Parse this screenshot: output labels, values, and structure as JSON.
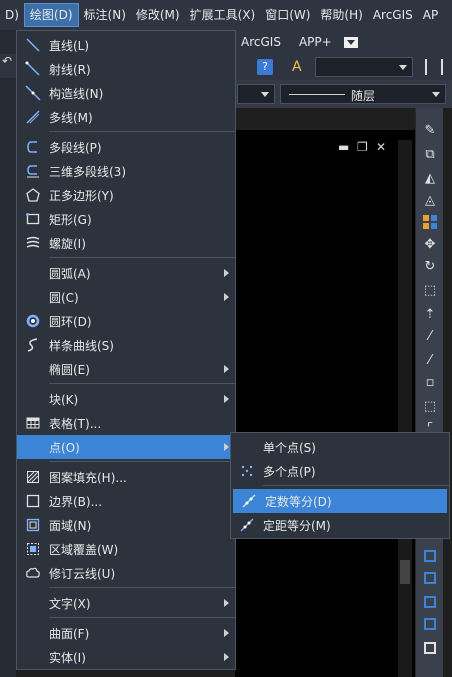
{
  "menubar": {
    "items": [
      "D)",
      "绘图(D)",
      "标注(N)",
      "修改(M)",
      "扩展工具(X)",
      "窗口(W)",
      "帮助(H)",
      "ArcGIS",
      "AP"
    ]
  },
  "toolbar": {
    "arcgis": "ArcGIS",
    "app_plus": "APP+",
    "layer_combo": "随层"
  },
  "draw_menu": {
    "items": [
      {
        "label": "直线(L)",
        "icon": "line-icon"
      },
      {
        "label": "射线(R)",
        "icon": "ray-icon"
      },
      {
        "label": "构造线(N)",
        "icon": "construction-line-icon"
      },
      {
        "label": "多线(M)",
        "icon": "multiline-icon"
      },
      {
        "label": "多段线(P)",
        "icon": "polyline-icon"
      },
      {
        "label": "三维多段线(3)",
        "icon": "3d-polyline-icon"
      },
      {
        "label": "正多边形(Y)",
        "icon": "polygon-icon"
      },
      {
        "label": "矩形(G)",
        "icon": "rectangle-icon"
      },
      {
        "label": "螺旋(I)",
        "icon": "helix-icon"
      },
      {
        "label": "圆弧(A)",
        "icon": "",
        "submenu": true
      },
      {
        "label": "圆(C)",
        "icon": "",
        "submenu": true
      },
      {
        "label": "圆环(D)",
        "icon": "donut-icon"
      },
      {
        "label": "样条曲线(S)",
        "icon": "spline-icon"
      },
      {
        "label": "椭圆(E)",
        "icon": "",
        "submenu": true
      },
      {
        "label": "块(K)",
        "icon": "",
        "submenu": true
      },
      {
        "label": "表格(T)...",
        "icon": "table-icon"
      },
      {
        "label": "点(O)",
        "icon": "",
        "submenu": true
      },
      {
        "label": "图案填充(H)...",
        "icon": "hatch-icon"
      },
      {
        "label": "边界(B)...",
        "icon": "boundary-icon"
      },
      {
        "label": "面域(N)",
        "icon": "region-icon"
      },
      {
        "label": "区域覆盖(W)",
        "icon": "wipeout-icon"
      },
      {
        "label": "修订云线(U)",
        "icon": "revcloud-icon"
      },
      {
        "label": "文字(X)",
        "icon": "",
        "submenu": true
      },
      {
        "label": "曲面(F)",
        "icon": "",
        "submenu": true
      },
      {
        "label": "实体(I)",
        "icon": "",
        "submenu": true
      }
    ]
  },
  "point_submenu": {
    "items": [
      {
        "label": "单个点(S)",
        "icon": ""
      },
      {
        "label": "多个点(P)",
        "icon": "multiple-points-icon"
      },
      {
        "label": "定数等分(D)",
        "icon": "divide-icon"
      },
      {
        "label": "定距等分(M)",
        "icon": "measure-icon"
      }
    ]
  },
  "canvas_controls": {
    "minimize": "▬",
    "restore": "❐",
    "close": "✕"
  },
  "colors": {
    "highlight": "#3b84d6",
    "menu_bg": "#2d333c",
    "menubar_bg": "#2f3540"
  }
}
